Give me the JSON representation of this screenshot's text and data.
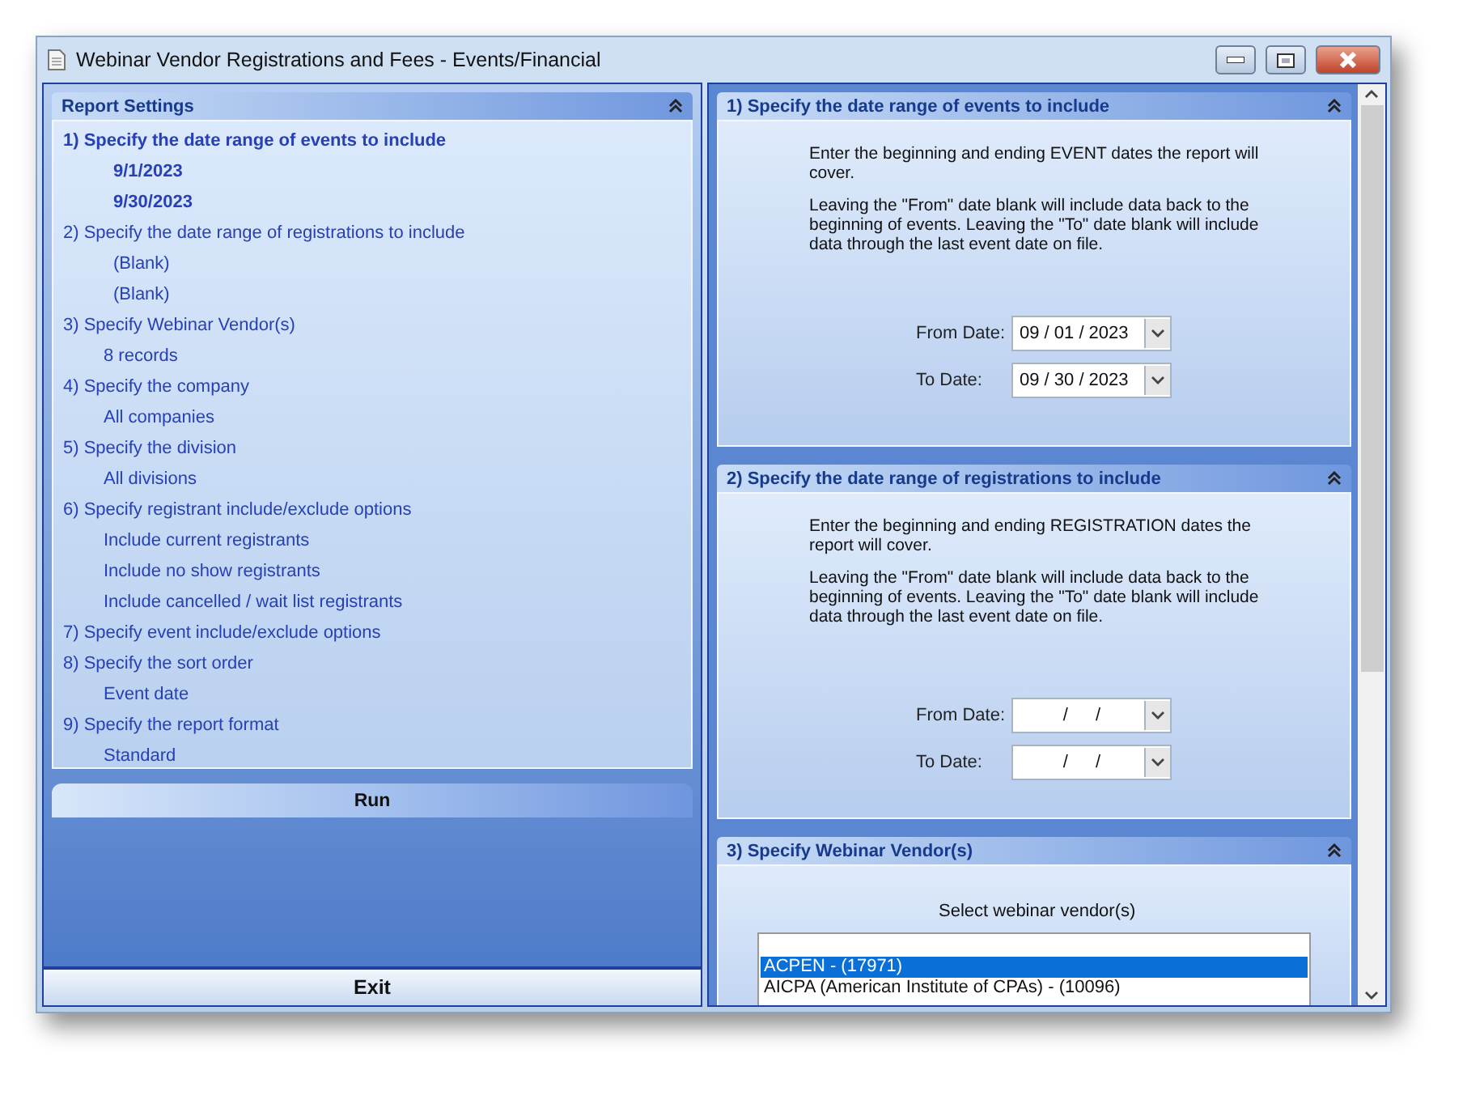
{
  "window": {
    "title": "Webinar Vendor Registrations and Fees - Events/Financial"
  },
  "report_settings": {
    "title": "Report Settings",
    "items": [
      {
        "label": "1)  Specify the date range of events to include",
        "selected": true,
        "children": [
          "9/1/2023",
          "9/30/2023"
        ]
      },
      {
        "label": "2)  Specify the date range of registrations to include",
        "selected": false,
        "children": [
          "(Blank)",
          "(Blank)"
        ]
      },
      {
        "label": "3)  Specify Webinar Vendor(s)",
        "selected": false,
        "children": [
          "8 records"
        ]
      },
      {
        "label": "4)  Specify the company",
        "selected": false,
        "children": [
          "All companies"
        ]
      },
      {
        "label": "5)  Specify the division",
        "selected": false,
        "children": [
          "All divisions"
        ]
      },
      {
        "label": "6)  Specify registrant include/exclude options",
        "selected": false,
        "children": [
          "Include current registrants",
          "Include no show registrants",
          "Include cancelled / wait list registrants"
        ]
      },
      {
        "label": "7)  Specify event include/exclude options",
        "selected": false
      },
      {
        "label": "8)  Specify the sort order",
        "selected": false,
        "children": [
          "Event date"
        ]
      },
      {
        "label": "9)  Specify the report format",
        "selected": false,
        "children": [
          "Standard"
        ]
      }
    ]
  },
  "run_button": "Run",
  "exit_button": "Exit",
  "sections": [
    {
      "kind": "date_range",
      "title": "1)  Specify the date range of events to include",
      "paragraphs": [
        "Enter the beginning and ending EVENT dates the report will cover.",
        "Leaving the \"From\" date blank will include data back to the beginning of events.  Leaving the \"To\" date blank will include data through the last event date on file."
      ],
      "fields": [
        {
          "label": "From Date:",
          "value": "09 / 01 / 2023"
        },
        {
          "label": "To Date:",
          "value": "09 / 30 / 2023"
        }
      ]
    },
    {
      "kind": "date_range",
      "title": "2)  Specify the date range of registrations to include",
      "paragraphs": [
        "Enter the beginning and ending REGISTRATION dates the report will cover.",
        "Leaving the \"From\" date blank will include data back to the beginning of events.  Leaving the \"To\" date blank will include data through the last event date on file."
      ],
      "fields": [
        {
          "label": "From Date:",
          "value": "/ /"
        },
        {
          "label": "To Date:",
          "value": "/ /"
        }
      ]
    },
    {
      "kind": "vendor_list",
      "title": "3)  Specify Webinar Vendor(s)",
      "prompt": "Select webinar vendor(s)",
      "options": [
        {
          "label": "ACPEN  - (17971)",
          "selected": true
        },
        {
          "label": "AICPA (American Institute of CPAs) - (10096)",
          "selected": false
        }
      ]
    }
  ]
}
